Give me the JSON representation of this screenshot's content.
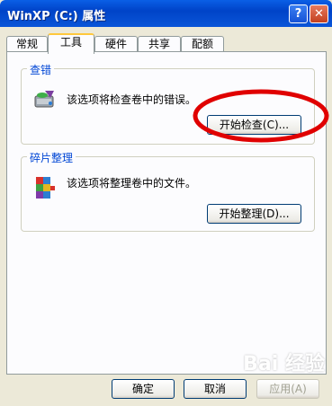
{
  "window": {
    "title": "WinXP (C:) 属性",
    "help_label": "?",
    "close_label": "✕"
  },
  "tabs": [
    {
      "label": "常规"
    },
    {
      "label": "工具"
    },
    {
      "label": "硬件"
    },
    {
      "label": "共享"
    },
    {
      "label": "配额"
    }
  ],
  "active_tab": "工具",
  "error_check": {
    "title": "查错",
    "description": "该选项将检查卷中的错误。",
    "button_label": "开始检查(C)...",
    "icon": "disk-check-icon"
  },
  "defrag": {
    "title": "碎片整理",
    "description": "该选项将整理卷中的文件。",
    "button_label": "开始整理(D)...",
    "icon": "defrag-icon"
  },
  "footer": {
    "ok_label": "确定",
    "cancel_label": "取消",
    "apply_label": "应用(A)"
  },
  "watermark": "Bai 经验",
  "colors": {
    "titlebar": "#0054e3",
    "group_title": "#0046d5",
    "annotation": "#e00000"
  }
}
